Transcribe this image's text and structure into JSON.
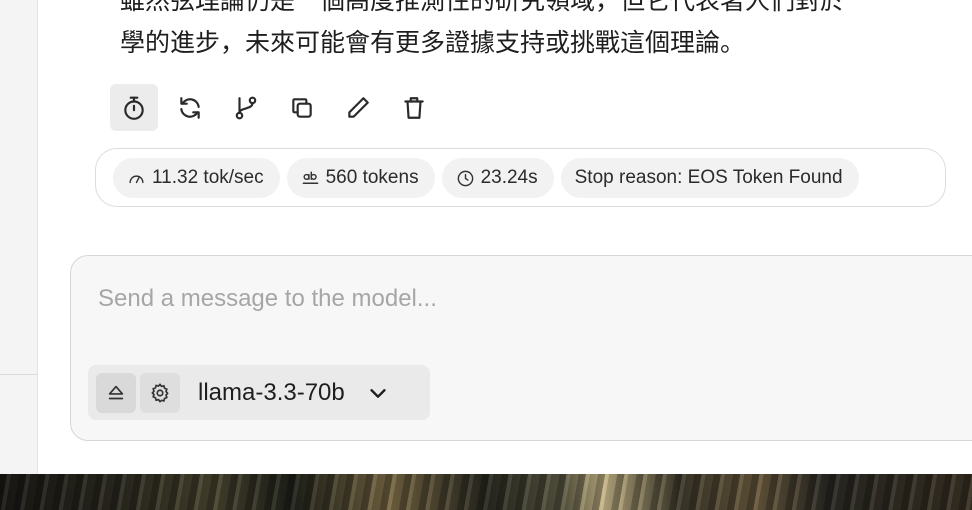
{
  "message": {
    "lines": [
      "雖然弦理論仍是一個高度推測性的研究領域，但它代表著人們對於",
      "學的進步，未來可能會有更多證據支持或挑戰這個理論。"
    ]
  },
  "actions": [
    {
      "icon": "stopwatch-icon"
    },
    {
      "icon": "regenerate-icon"
    },
    {
      "icon": "branch-icon"
    },
    {
      "icon": "copy-icon"
    },
    {
      "icon": "edit-icon"
    },
    {
      "icon": "delete-icon"
    }
  ],
  "stats": {
    "speed": "11.32 tok/sec",
    "tokens": "560 tokens",
    "time": "23.24s",
    "stop_reason": "Stop reason: EOS Token Found"
  },
  "composer": {
    "placeholder": "Send a message to the model...",
    "model_name": "llama-3.3-70b"
  }
}
